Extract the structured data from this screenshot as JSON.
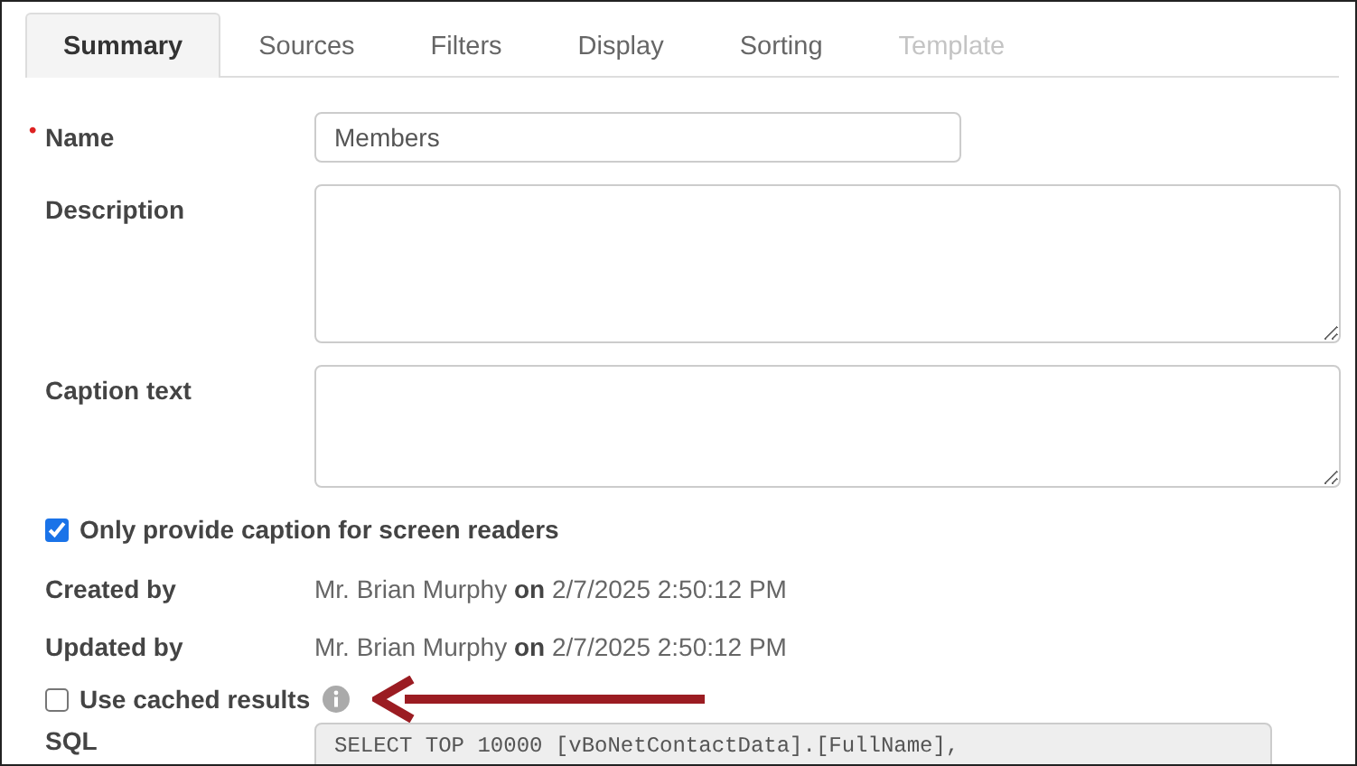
{
  "tabs": [
    {
      "label": "Summary",
      "selected": true,
      "disabled": false
    },
    {
      "label": "Sources",
      "selected": false,
      "disabled": false
    },
    {
      "label": "Filters",
      "selected": false,
      "disabled": false
    },
    {
      "label": "Display",
      "selected": false,
      "disabled": false
    },
    {
      "label": "Sorting",
      "selected": false,
      "disabled": false
    },
    {
      "label": "Template",
      "selected": false,
      "disabled": true
    }
  ],
  "fields": [
    {
      "kind": "input",
      "label": "Name",
      "required_mark": "•",
      "value": "Members"
    },
    {
      "kind": "textarea",
      "label": "Description"
    },
    {
      "kind": "textarea",
      "label": "Caption text"
    },
    {
      "kind": "checkbox",
      "label": "Only provide caption for screen readers",
      "checked": true
    },
    {
      "kind": "info",
      "label": "Created by",
      "value": "Mr. Brian Murphy **on** 2/7/2025 2:50:12 PM"
    },
    {
      "kind": "info",
      "label": "Updated by",
      "value": "Mr. Brian Murphy **on** 2/7/2025 2:50:12 PM"
    },
    {
      "kind": "checkbox",
      "label": "Use cached results",
      "checked": false,
      "info_icon": true,
      "arrow": true
    },
    {
      "kind": "code",
      "label": "SQL",
      "value": "SELECT TOP 10000 [vBoNetContactData].[FullName],"
    }
  ]
}
